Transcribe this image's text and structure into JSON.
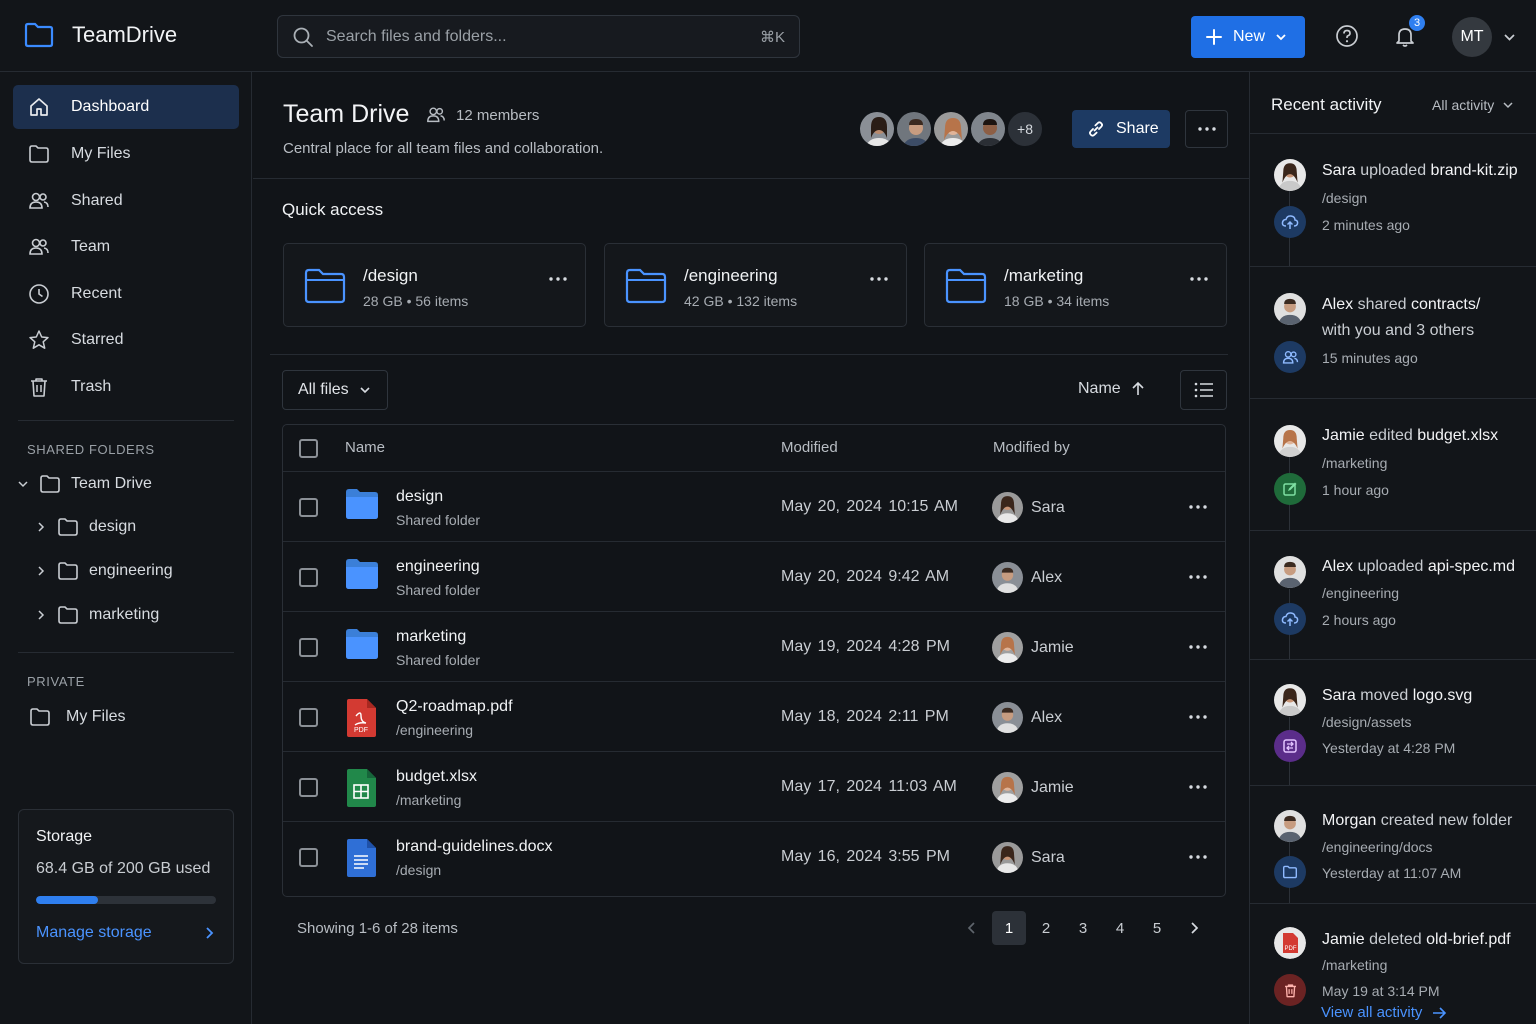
{
  "app": {
    "name": "TeamDrive"
  },
  "search": {
    "placeholder": "Search files and folders...",
    "shortcut": "⌘K"
  },
  "header": {
    "new_label": "New",
    "notifications_count": "3",
    "user_initials": "MT"
  },
  "sidebar": {
    "items": [
      {
        "label": "Dashboard",
        "icon": "home-icon",
        "active": true
      },
      {
        "label": "My Files",
        "icon": "folder-icon"
      },
      {
        "label": "Shared",
        "icon": "users-icon"
      },
      {
        "label": "Team",
        "icon": "team-icon"
      },
      {
        "label": "Recent",
        "icon": "clock-icon"
      },
      {
        "label": "Starred",
        "icon": "star-icon"
      },
      {
        "label": "Trash",
        "icon": "trash-icon"
      }
    ],
    "shared_label": "SHARED FOLDERS",
    "shared_root": "Team Drive",
    "shared_children": [
      "design",
      "engineering",
      "marketing"
    ],
    "private_label": "PRIVATE",
    "private_items": [
      "My Files"
    ]
  },
  "storage": {
    "title": "Storage",
    "used_text": "68.4 GB of 200 GB used",
    "used_fraction": 0.342,
    "manage_label": "Manage storage"
  },
  "drive": {
    "title": "Team Drive",
    "members": "12 members",
    "description": "Central place for all team files and collaboration.",
    "more_members": "+8",
    "share_label": "Share"
  },
  "quick_access": {
    "title": "Quick access",
    "items": [
      {
        "name": "/design",
        "size": "28 GB",
        "count": "56 items"
      },
      {
        "name": "/engineering",
        "size": "42 GB",
        "count": "132 items"
      },
      {
        "name": "/marketing",
        "size": "18 GB",
        "count": "34 items"
      }
    ]
  },
  "files": {
    "filter_label": "All files",
    "sort_label": "Name",
    "columns": {
      "name": "Name",
      "modified": "Modified",
      "modified_by": "Modified by"
    },
    "rows": [
      {
        "name": "design",
        "sub": "Shared folder",
        "date": "May 20, 2024  10:15 AM",
        "by": "Sara",
        "type": "folder"
      },
      {
        "name": "engineering",
        "sub": "Shared folder",
        "date": "May 20, 2024  9:42 AM",
        "by": "Alex",
        "type": "folder"
      },
      {
        "name": "marketing",
        "sub": "Shared folder",
        "date": "May 19, 2024  4:28 PM",
        "by": "Jamie",
        "type": "folder"
      },
      {
        "name": "Q2-roadmap.pdf",
        "sub": "/engineering",
        "date": "May 18, 2024  2:11 PM",
        "by": "Alex",
        "type": "pdf"
      },
      {
        "name": "budget.xlsx",
        "sub": "/marketing",
        "date": "May 17, 2024  11:03 AM",
        "by": "Jamie",
        "type": "sheet"
      },
      {
        "name": "brand-guidelines.docx",
        "sub": "/design",
        "date": "May 16, 2024  3:55 PM",
        "by": "Sara",
        "type": "doc"
      }
    ],
    "showing": "Showing 1-6 of 28 items",
    "pages": [
      "1",
      "2",
      "3",
      "4",
      "5"
    ],
    "current_page": "1"
  },
  "activity": {
    "title": "Recent activity",
    "filter_label": "All activity",
    "view_all": "View all activity",
    "items": [
      {
        "user": "Sara",
        "action": "uploaded",
        "target": "brand-kit.zip",
        "extra": "",
        "path": "/design",
        "time": "2 minutes ago",
        "icon": "upload-icon",
        "color": "#1d3a63"
      },
      {
        "user": "Alex",
        "action": "shared",
        "target": "contracts/",
        "extra": "with you and 3 others",
        "path": "",
        "time": "15 minutes ago",
        "icon": "users-icon",
        "color": "#1d3a63"
      },
      {
        "user": "Jamie",
        "action": "edited",
        "target": "budget.xlsx",
        "extra": "",
        "path": "/marketing",
        "time": "1 hour ago",
        "icon": "edit-icon",
        "color": "#1f6b3a"
      },
      {
        "user": "Alex",
        "action": "uploaded",
        "target": "api-spec.md",
        "extra": "",
        "path": "/engineering",
        "time": "2 hours ago",
        "icon": "upload-icon",
        "color": "#1d3a63"
      },
      {
        "user": "Sara",
        "action": "moved",
        "target": "logo.svg",
        "extra": "",
        "path": "/design/assets",
        "time": "Yesterday at 4:28 PM",
        "icon": "move-icon",
        "color": "#5b2d8a"
      },
      {
        "user": "Morgan",
        "action": "created new folder",
        "target": "",
        "extra": "",
        "path": "/engineering/docs",
        "time": "Yesterday at 11:07 AM",
        "icon": "folder-icon",
        "color": "#1d3a63"
      },
      {
        "user": "Jamie",
        "action": "deleted",
        "target": "old-brief.pdf",
        "extra": "",
        "path": "/marketing",
        "time": "May 19 at 3:14 PM",
        "icon": "trash-icon",
        "color": "#6b2323"
      }
    ]
  }
}
